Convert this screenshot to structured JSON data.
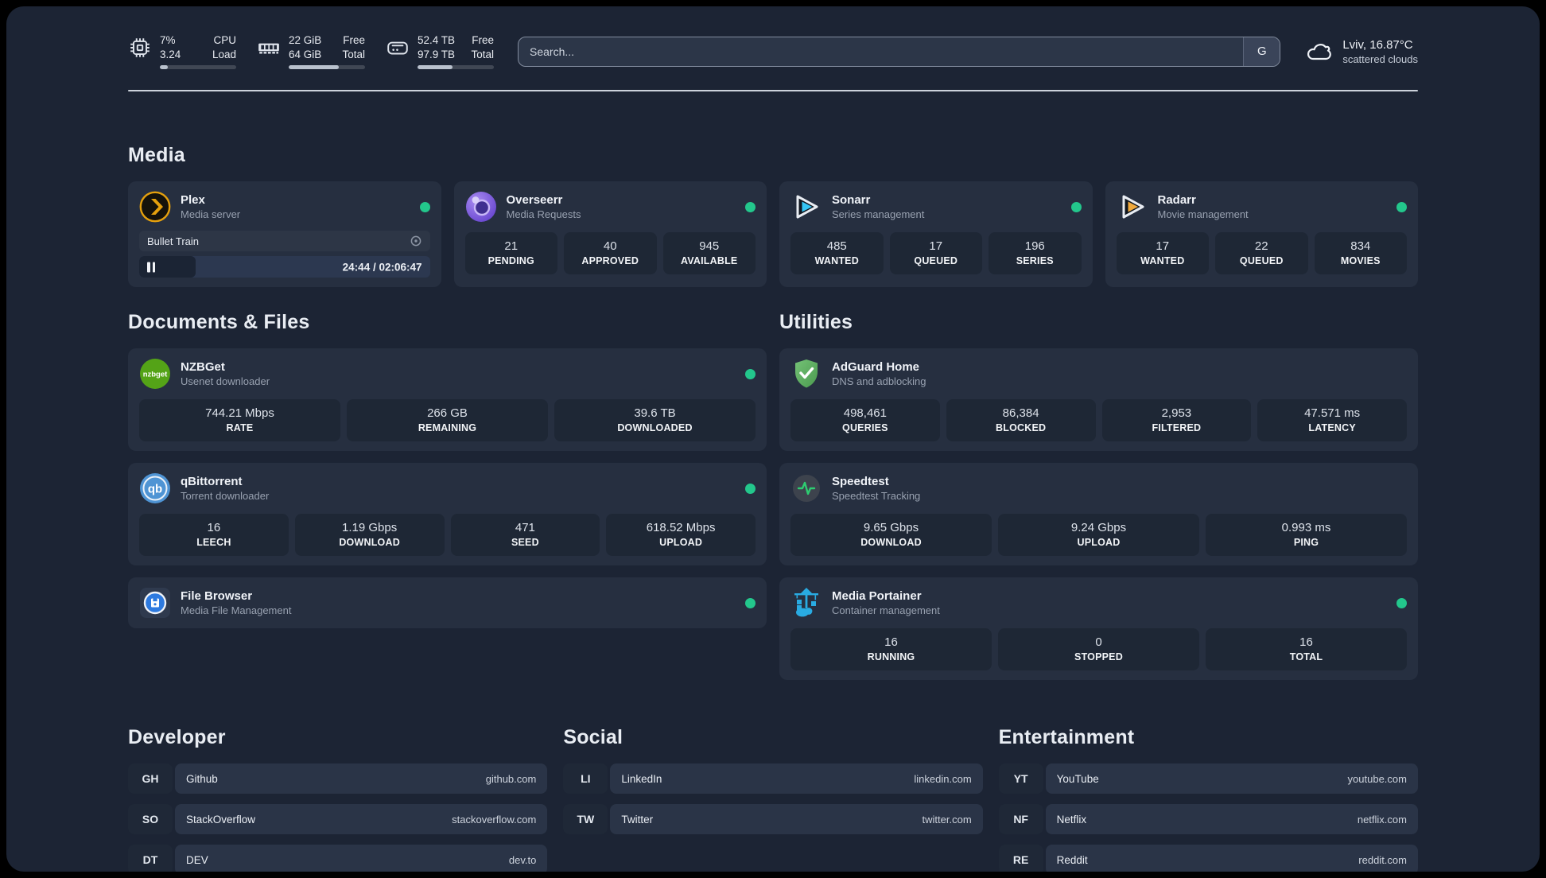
{
  "colors": {
    "status_online": "#23c78c",
    "accent_plex": "#e5a00d",
    "accent_sonarr": "#35c5f4",
    "accent_radarr": "#f0a93c",
    "accent_portainer": "#29abe2",
    "accent_adguard": "#5fb85f",
    "accent_speedtest": "#2ecc71"
  },
  "topbar": {
    "cpu": {
      "value_top": "7%",
      "value_bottom": "3.24",
      "label_top": "CPU",
      "label_bottom": "Load",
      "progress": 10
    },
    "ram": {
      "value_top": "22 GiB",
      "value_bottom": "64 GiB",
      "label_top": "Free",
      "label_bottom": "Total",
      "progress": 66
    },
    "disk": {
      "value_top": "52.4 TB",
      "value_bottom": "97.9 TB",
      "label_top": "Free",
      "label_bottom": "Total",
      "progress": 46
    },
    "search": {
      "placeholder": "Search...",
      "engine_label": "G"
    },
    "weather": {
      "location_temp": "Lviv, 16.87°C",
      "condition": "scattered clouds"
    }
  },
  "media": {
    "title": "Media",
    "plex": {
      "name": "Plex",
      "subtitle": "Media server",
      "player": {
        "title": "Bullet Train",
        "time_display": "24:44 / 02:06:47",
        "progress_pct": 19.5
      }
    },
    "overseerr": {
      "name": "Overseerr",
      "subtitle": "Media Requests",
      "stats": [
        {
          "value": "21",
          "label": "PENDING"
        },
        {
          "value": "40",
          "label": "APPROVED"
        },
        {
          "value": "945",
          "label": "AVAILABLE"
        }
      ]
    },
    "sonarr": {
      "name": "Sonarr",
      "subtitle": "Series management",
      "stats": [
        {
          "value": "485",
          "label": "WANTED"
        },
        {
          "value": "17",
          "label": "QUEUED"
        },
        {
          "value": "196",
          "label": "SERIES"
        }
      ]
    },
    "radarr": {
      "name": "Radarr",
      "subtitle": "Movie management",
      "stats": [
        {
          "value": "17",
          "label": "WANTED"
        },
        {
          "value": "22",
          "label": "QUEUED"
        },
        {
          "value": "834",
          "label": "MOVIES"
        }
      ]
    }
  },
  "docs": {
    "title": "Documents & Files",
    "nzbget": {
      "name": "NZBGet",
      "subtitle": "Usenet downloader",
      "stats": [
        {
          "value": "744.21 Mbps",
          "label": "RATE"
        },
        {
          "value": "266 GB",
          "label": "REMAINING"
        },
        {
          "value": "39.6 TB",
          "label": "DOWNLOADED"
        }
      ]
    },
    "qbittorrent": {
      "name": "qBittorrent",
      "subtitle": "Torrent downloader",
      "stats": [
        {
          "value": "16",
          "label": "LEECH"
        },
        {
          "value": "1.19 Gbps",
          "label": "DOWNLOAD"
        },
        {
          "value": "471",
          "label": "SEED"
        },
        {
          "value": "618.52 Mbps",
          "label": "UPLOAD"
        }
      ]
    },
    "filebrowser": {
      "name": "File Browser",
      "subtitle": "Media File Management"
    }
  },
  "utils": {
    "title": "Utilities",
    "adguard": {
      "name": "AdGuard Home",
      "subtitle": "DNS and adblocking",
      "stats": [
        {
          "value": "498,461",
          "label": "QUERIES"
        },
        {
          "value": "86,384",
          "label": "BLOCKED"
        },
        {
          "value": "2,953",
          "label": "FILTERED"
        },
        {
          "value": "47.571 ms",
          "label": "LATENCY"
        }
      ]
    },
    "speedtest": {
      "name": "Speedtest",
      "subtitle": "Speedtest Tracking",
      "stats": [
        {
          "value": "9.65 Gbps",
          "label": "DOWNLOAD"
        },
        {
          "value": "9.24 Gbps",
          "label": "UPLOAD"
        },
        {
          "value": "0.993 ms",
          "label": "PING"
        }
      ]
    },
    "portainer": {
      "name": "Media Portainer",
      "subtitle": "Container management",
      "stats": [
        {
          "value": "16",
          "label": "RUNNING"
        },
        {
          "value": "0",
          "label": "STOPPED"
        },
        {
          "value": "16",
          "label": "TOTAL"
        }
      ]
    }
  },
  "bookmarks": {
    "developer": {
      "title": "Developer",
      "items": [
        {
          "abbr": "GH",
          "name": "Github",
          "url": "github.com"
        },
        {
          "abbr": "SO",
          "name": "StackOverflow",
          "url": "stackoverflow.com"
        },
        {
          "abbr": "DT",
          "name": "DEV",
          "url": "dev.to"
        }
      ]
    },
    "social": {
      "title": "Social",
      "items": [
        {
          "abbr": "LI",
          "name": "LinkedIn",
          "url": "linkedin.com"
        },
        {
          "abbr": "TW",
          "name": "Twitter",
          "url": "twitter.com"
        }
      ]
    },
    "entertainment": {
      "title": "Entertainment",
      "items": [
        {
          "abbr": "YT",
          "name": "YouTube",
          "url": "youtube.com"
        },
        {
          "abbr": "NF",
          "name": "Netflix",
          "url": "netflix.com"
        },
        {
          "abbr": "RE",
          "name": "Reddit",
          "url": "reddit.com"
        }
      ]
    }
  }
}
